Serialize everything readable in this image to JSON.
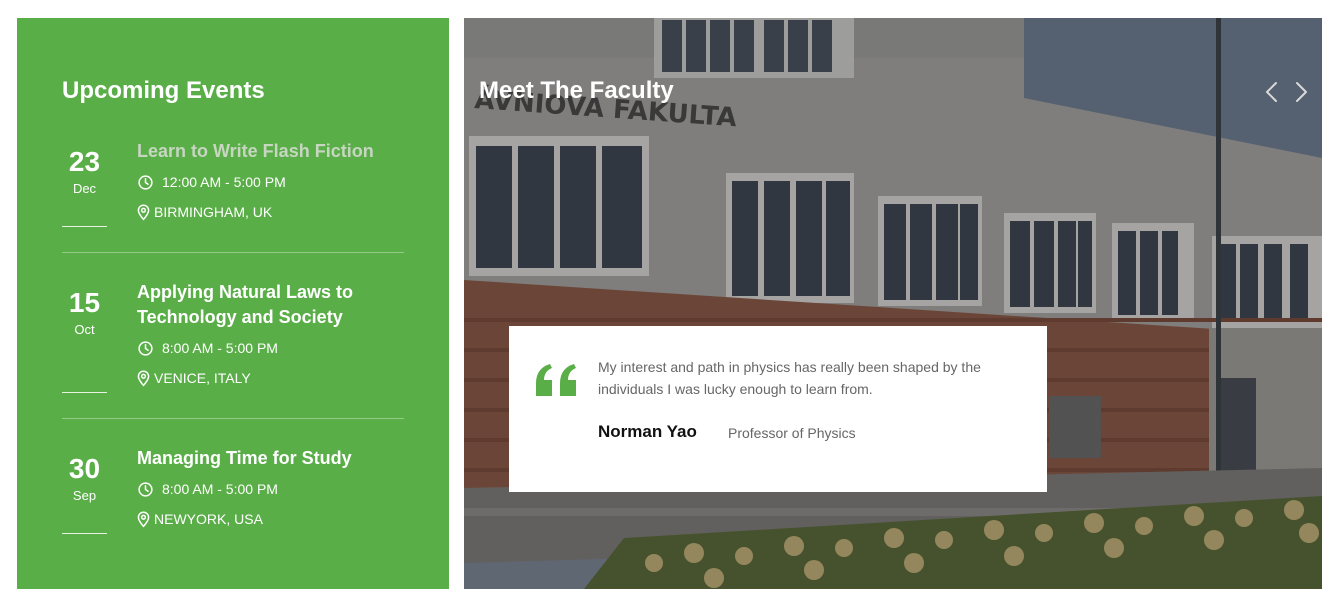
{
  "events": {
    "title": "Upcoming Events",
    "items": [
      {
        "day": "23",
        "month": "Dec",
        "title": "Learn to Write Flash Fiction",
        "time": "12:00 AM - 5:00 PM",
        "location": "BIRMINGHAM, UK"
      },
      {
        "day": "15",
        "month": "Oct",
        "title": "Applying Natural Laws to Technology and Society",
        "time": "8:00 AM - 5:00 PM",
        "location": "VENICE, ITALY"
      },
      {
        "day": "30",
        "month": "Sep",
        "title": "Managing Time for Study",
        "time": "8:00 AM - 5:00 PM",
        "location": "NEWYORK, USA"
      }
    ]
  },
  "faculty": {
    "title": "Meet The Faculty",
    "building_sign": "ÁVNIOVA FAKULTA",
    "quote": "My interest and path in physics has really been shaped by the individuals I was lucky enough to learn from.",
    "author": "Norman Yao",
    "role": "Professor of Physics"
  },
  "icons": {
    "clock": "clock-icon",
    "location": "map-pin-icon",
    "quote": "quote-icon",
    "prev": "chevron-left-icon",
    "next": "chevron-right-icon"
  },
  "colors": {
    "events_panel": "#5aae48",
    "quote_mark": "#5aae48",
    "muted_event_title": "#c6d6c0",
    "card_background": "#ffffff"
  }
}
